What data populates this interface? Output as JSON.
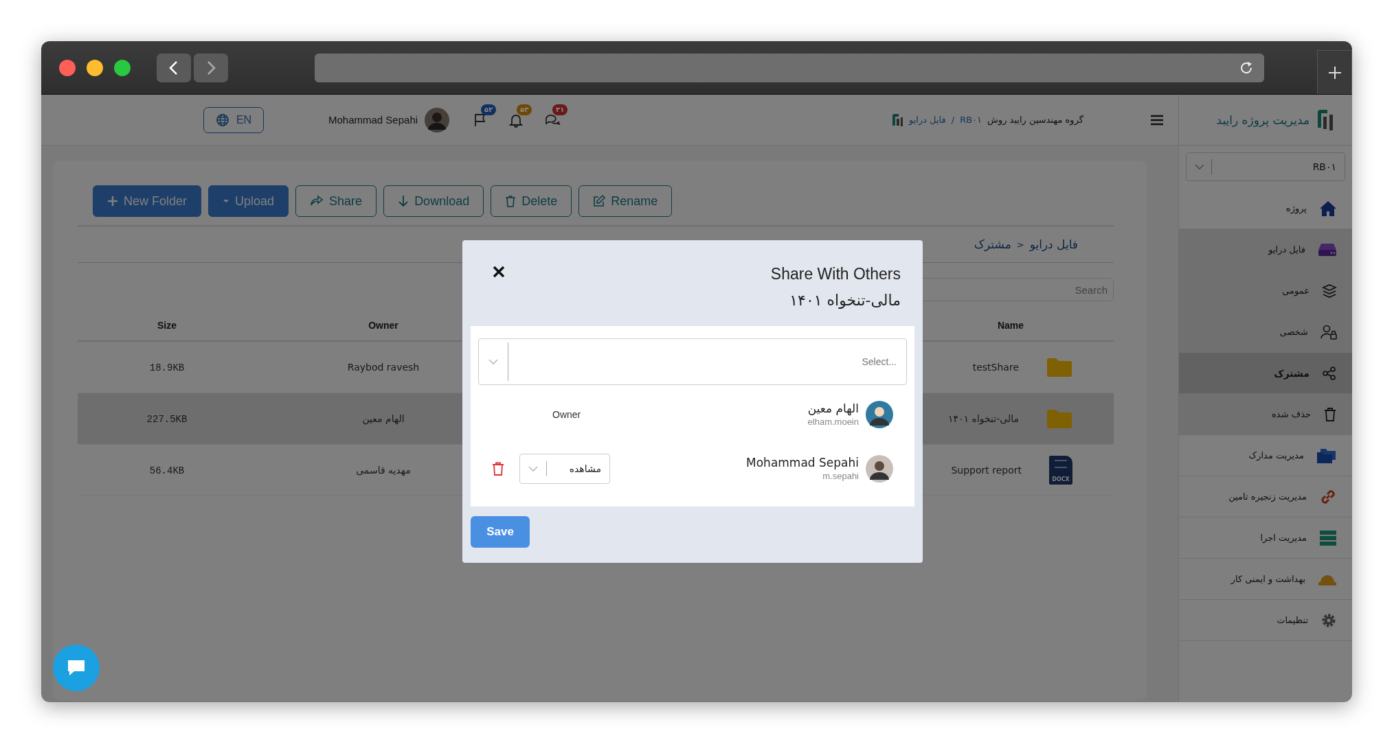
{
  "header": {
    "language": "EN",
    "user_name": "Mohammad Sepahi",
    "notifications": [
      {
        "count": "۳۱",
        "color": "#6a1818"
      },
      {
        "count": "۵۳",
        "color": "#704805"
      },
      {
        "count": "۵۲",
        "color": "#103062"
      }
    ],
    "breadcrumb": [
      {
        "label": "گروه مهندسین رایبد روش",
        "kind": "text"
      },
      {
        "label": "RB۰۱",
        "kind": "link"
      },
      {
        "label": "/",
        "kind": "separator"
      },
      {
        "label": "فایل درایو",
        "kind": "link"
      }
    ]
  },
  "sidebar": {
    "brand": "مدیریت پروژه رایبد",
    "project": "RB۰۱",
    "items": [
      {
        "label": "پروژه",
        "selected": false
      },
      {
        "label": "فایل درایو",
        "selected": false,
        "expanded": true,
        "children": [
          {
            "label": "عمومی",
            "selected": false
          },
          {
            "label": "شخصی",
            "selected": false
          },
          {
            "label": "مشترک",
            "selected": true
          },
          {
            "label": "حذف شده",
            "selected": false
          }
        ]
      },
      {
        "label": "مدیریت مدارک",
        "selected": false
      },
      {
        "label": "مدیریت زنجیره تامین",
        "selected": false
      },
      {
        "label": "مدیریت اجرا",
        "selected": false
      },
      {
        "label": "بهداشت و ایمنی کار",
        "selected": false
      },
      {
        "label": "تنظیمات",
        "selected": false
      }
    ]
  },
  "toolbar": [
    {
      "label": "Rename",
      "kind": "outline"
    },
    {
      "label": "Delete",
      "kind": "outline"
    },
    {
      "label": "Download",
      "kind": "outline"
    },
    {
      "label": "Share",
      "kind": "outline"
    },
    {
      "label": "Upload",
      "kind": "primary"
    },
    {
      "label": "New Folder",
      "kind": "primary"
    }
  ],
  "path": [
    {
      "label": "فایل درایو"
    },
    {
      "label": ">"
    },
    {
      "label": "مشترک"
    }
  ],
  "search": {
    "placeholder": "Search"
  },
  "table": {
    "columns": [
      "Name",
      "Owner",
      "Size"
    ],
    "rows": [
      {
        "name": "testShare",
        "kind": "folder",
        "owner": "Raybod ravesh",
        "size": "18.9KB",
        "selected": false
      },
      {
        "name": "مالی-تنخواه ۱۴۰۱",
        "kind": "folder",
        "owner": "الهام معین",
        "size": "227.5KB",
        "selected": true
      },
      {
        "name": "Support report",
        "kind": "docx",
        "file_label": "DOCX",
        "owner": "مهدیه قاسمی",
        "size": "56.4KB",
        "selected": false
      }
    ]
  },
  "modal": {
    "title": "Share With Others",
    "subtitle": "مالی-تنخواه ۱۴۰۱",
    "select_placeholder": "Select...",
    "members": [
      {
        "kind": "owner",
        "name": "الهام معین",
        "username": "elham.moein",
        "role": "Owner"
      },
      {
        "kind": "editor",
        "name": "Mohammad Sepahi",
        "username": "m.sepahi",
        "permission": "مشاهده"
      }
    ],
    "save": "Save"
  }
}
